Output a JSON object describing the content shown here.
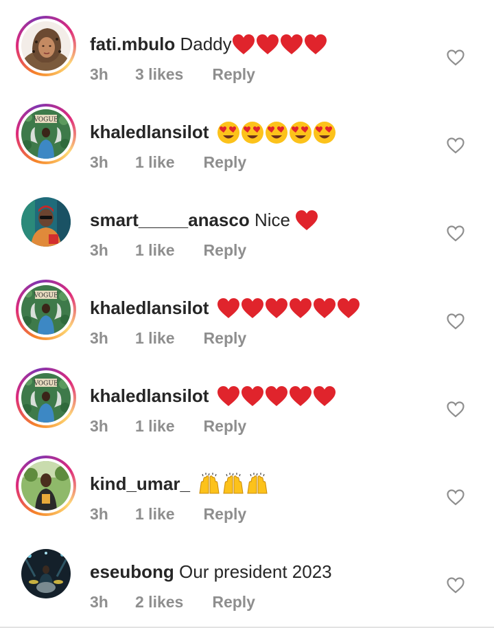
{
  "colors": {
    "text_primary": "#262626",
    "text_secondary": "#8e8e8e",
    "heart_red": "#e0242c",
    "story_ring": [
      "#f58529",
      "#dd2a7b",
      "#8134af"
    ]
  },
  "comments": [
    {
      "username": "fati.mbulo",
      "text": "Daddy",
      "emoji": [
        "red-heart-icon",
        "red-heart-icon",
        "red-heart-icon",
        "red-heart-icon"
      ],
      "time": "3h",
      "likes": "3 likes",
      "reply": "Reply",
      "has_story_ring": true,
      "avatar": "avatar-woman-headscarf"
    },
    {
      "username": "khaledlansilot",
      "text": "",
      "emoji": [
        "heart-eyes-icon",
        "heart-eyes-icon",
        "heart-eyes-icon",
        "heart-eyes-icon",
        "heart-eyes-icon"
      ],
      "time": "3h",
      "likes": "1 like",
      "reply": "Reply",
      "has_story_ring": true,
      "avatar": "avatar-vogue-backdrop"
    },
    {
      "username": "smart_____anasco",
      "text": "Nice",
      "emoji": [
        "red-heart-icon"
      ],
      "time": "3h",
      "likes": "1 like",
      "reply": "Reply",
      "has_story_ring": false,
      "avatar": "avatar-man-red-cap"
    },
    {
      "username": "khaledlansilot",
      "text": "",
      "emoji": [
        "red-heart-icon",
        "red-heart-icon",
        "red-heart-icon",
        "red-heart-icon",
        "red-heart-icon",
        "red-heart-icon"
      ],
      "time": "3h",
      "likes": "1 like",
      "reply": "Reply",
      "has_story_ring": true,
      "avatar": "avatar-vogue-backdrop"
    },
    {
      "username": "khaledlansilot",
      "text": "",
      "emoji": [
        "red-heart-icon",
        "red-heart-icon",
        "red-heart-icon",
        "red-heart-icon",
        "red-heart-icon"
      ],
      "time": "3h",
      "likes": "1 like",
      "reply": "Reply",
      "has_story_ring": true,
      "avatar": "avatar-vogue-backdrop"
    },
    {
      "username": "kind_umar_",
      "text": "",
      "emoji": [
        "raising-hands-icon",
        "raising-hands-icon",
        "raising-hands-icon"
      ],
      "time": "3h",
      "likes": "1 like",
      "reply": "Reply",
      "has_story_ring": true,
      "avatar": "avatar-man-outdoors"
    },
    {
      "username": "eseubong",
      "text": "Our president 2023",
      "emoji": [],
      "time": "3h",
      "likes": "2 likes",
      "reply": "Reply",
      "has_story_ring": false,
      "avatar": "avatar-drummer-stage"
    }
  ]
}
